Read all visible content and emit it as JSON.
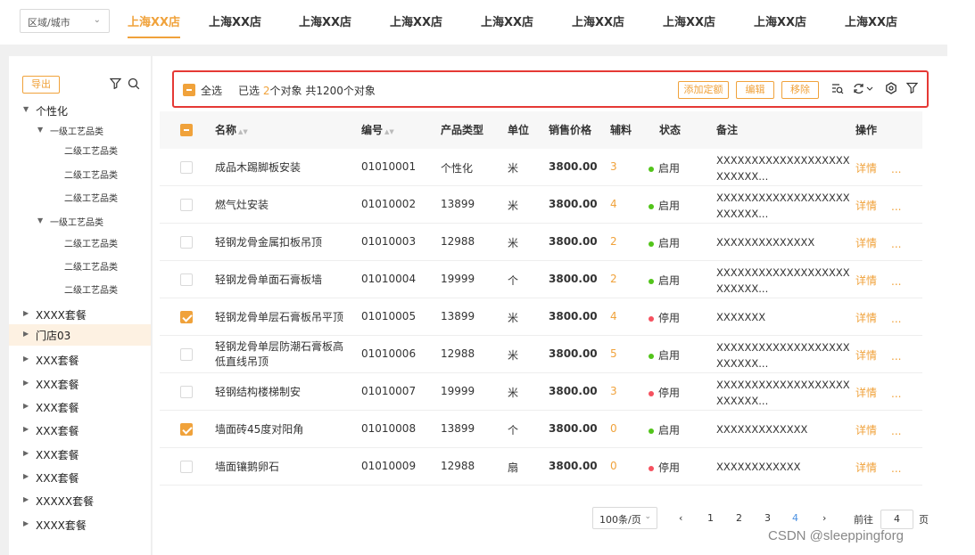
{
  "header": {
    "city_select": {
      "value": "区域/城市"
    },
    "store_tabs": [
      "上海XX店",
      "上海XX店",
      "上海XX店",
      "上海XX店",
      "上海XX店",
      "上海XX店",
      "上海XX店",
      "上海XX店",
      "上海XX店"
    ],
    "active_tab_index": 0
  },
  "sidebar": {
    "export_label": "导出",
    "tree": [
      {
        "label": "个性化",
        "level": 0,
        "expanded": true
      },
      {
        "label": "一级工艺品类",
        "level": 1,
        "expanded": true
      },
      {
        "label": "二级工艺品类",
        "level": 2
      },
      {
        "label": "二级工艺品类",
        "level": 2
      },
      {
        "label": "二级工艺品类",
        "level": 2
      },
      {
        "label": "一级工艺品类",
        "level": 1,
        "expanded": true
      },
      {
        "label": "二级工艺品类",
        "level": 2
      },
      {
        "label": "二级工艺品类",
        "level": 2
      },
      {
        "label": "二级工艺品类",
        "level": 2
      },
      {
        "label": "XXXX套餐",
        "level": 0
      },
      {
        "label": "门店03",
        "level": 0,
        "selected": true
      },
      {
        "label": "XXX套餐",
        "level": 0
      },
      {
        "label": "XXX套餐",
        "level": 0
      },
      {
        "label": "XXX套餐",
        "level": 0
      },
      {
        "label": "XXX套餐",
        "level": 0
      },
      {
        "label": "XXX套餐",
        "level": 0
      },
      {
        "label": "XXX套餐",
        "level": 0
      },
      {
        "label": "XXXXX套餐",
        "level": 0
      },
      {
        "label": "XXXX套餐",
        "level": 0
      }
    ]
  },
  "toolbar": {
    "select_all": "全选",
    "selected_prefix": "已选",
    "selected_count": "2",
    "selected_suffix": "个对象",
    "total_text": "共1200个对象",
    "add_quota": "添加定额",
    "edit": "编辑",
    "remove": "移除"
  },
  "table": {
    "columns": {
      "name": "名称",
      "code": "编号",
      "type": "产品类型",
      "unit": "单位",
      "price": "销售价格",
      "aux": "辅料",
      "status": "状态",
      "remark": "备注",
      "action": "操作"
    },
    "detail_label": "详情",
    "more_label": "...",
    "rows": [
      {
        "checked": false,
        "name": "成品木踢脚板安装",
        "code": "01010001",
        "type": "个性化",
        "unit": "米",
        "price": "3800.00",
        "aux": "3",
        "status": "启用",
        "status_color": "#52c41a",
        "remark": "XXXXXXXXXXXXXXXXXXXXXXXXX..."
      },
      {
        "checked": false,
        "name": "燃气灶安装",
        "code": "01010002",
        "type": "13899",
        "unit": "米",
        "price": "3800.00",
        "aux": "4",
        "status": "启用",
        "status_color": "#52c41a",
        "remark": "XXXXXXXXXXXXXXXXXXXXXXXXX..."
      },
      {
        "checked": false,
        "name": "轻钢龙骨金属扣板吊顶",
        "code": "01010003",
        "type": "12988",
        "unit": "米",
        "price": "3800.00",
        "aux": "2",
        "status": "启用",
        "status_color": "#52c41a",
        "remark": "XXXXXXXXXXXXXX"
      },
      {
        "checked": false,
        "name": "轻钢龙骨单面石膏板墙",
        "code": "01010004",
        "type": "19999",
        "unit": "个",
        "price": "3800.00",
        "aux": "2",
        "status": "启用",
        "status_color": "#52c41a",
        "remark": "XXXXXXXXXXXXXXXXXXXXXXXXX..."
      },
      {
        "checked": true,
        "name": "轻钢龙骨单层石膏板吊平顶",
        "code": "01010005",
        "type": "13899",
        "unit": "米",
        "price": "3800.00",
        "aux": "4",
        "status": "停用",
        "status_color": "#f5515f",
        "remark": "XXXXXXX"
      },
      {
        "checked": false,
        "name": "轻钢龙骨单层防潮石膏板高低直线吊顶",
        "code": "01010006",
        "type": "12988",
        "unit": "米",
        "price": "3800.00",
        "aux": "5",
        "status": "启用",
        "status_color": "#52c41a",
        "remark": "XXXXXXXXXXXXXXXXXXXXXXXXX..."
      },
      {
        "checked": false,
        "name": "轻钢结构楼梯制安",
        "code": "01010007",
        "type": "19999",
        "unit": "米",
        "price": "3800.00",
        "aux": "3",
        "status": "停用",
        "status_color": "#f5515f",
        "remark": "XXXXXXXXXXXXXXXXXXXXXXXXX..."
      },
      {
        "checked": true,
        "name": "墙面砖45度对阳角",
        "code": "01010008",
        "type": "13899",
        "unit": "个",
        "price": "3800.00",
        "aux": "0",
        "status": "启用",
        "status_color": "#52c41a",
        "remark": "XXXXXXXXXXXXX"
      },
      {
        "checked": false,
        "name": "墙面镶鹅卵石",
        "code": "01010009",
        "type": "12988",
        "unit": "扇",
        "price": "3800.00",
        "aux": "0",
        "status": "停用",
        "status_color": "#f5515f",
        "remark": "XXXXXXXXXXXX"
      }
    ]
  },
  "pagination": {
    "page_size": "100条/页",
    "prev": "‹",
    "next": "›",
    "pages": [
      "1",
      "2",
      "3",
      "4"
    ],
    "current_page": "4",
    "goto_label": "前往",
    "goto_value": "4",
    "goto_suffix": "页"
  },
  "watermark": "CSDN @sleeppingforg",
  "colors": {
    "accent": "#f0a23b",
    "enabled": "#52c41a",
    "disabled": "#f5515f",
    "highlight_border": "#e53935",
    "page_active": "#4a90e2"
  }
}
